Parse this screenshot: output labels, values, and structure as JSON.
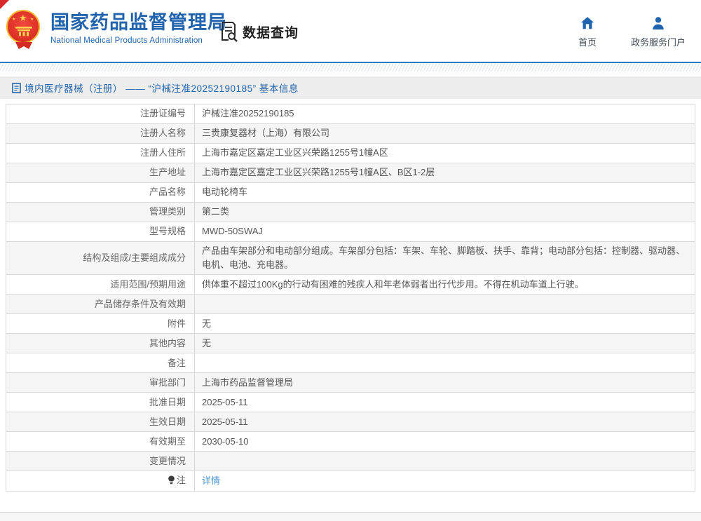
{
  "header": {
    "org_name_cn": "国家药品监督管理局",
    "org_name_en": "National Medical Products Administration",
    "module_title": "数据查询",
    "nav": {
      "home_label": "首页",
      "portal_label": "政务服务门户"
    }
  },
  "breadcrumb": {
    "text": "境内医疗器械（注册） —— “沪械注准20252190185” 基本信息"
  },
  "table": {
    "rows": [
      {
        "label": "注册证编号",
        "value": "沪械注准20252190185"
      },
      {
        "label": "注册人名称",
        "value": "三贵康复器材（上海）有限公司"
      },
      {
        "label": "注册人住所",
        "value": "上海市嘉定区嘉定工业区兴荣路1255号1幢A区"
      },
      {
        "label": "生产地址",
        "value": "上海市嘉定区嘉定工业区兴荣路1255号1幢A区、B区1-2层"
      },
      {
        "label": "产品名称",
        "value": "电动轮椅车"
      },
      {
        "label": "管理类别",
        "value": "第二类"
      },
      {
        "label": "型号规格",
        "value": "MWD-50SWAJ"
      },
      {
        "label": "结构及组成/主要组成成分",
        "value": "产品由车架部分和电动部分组成。车架部分包括：车架、车轮、脚踏板、扶手、靠背；电动部分包括：控制器、驱动器、电机、电池、充电器。"
      },
      {
        "label": "适用范围/预期用途",
        "value": "供体重不超过100Kg的行动有困难的残疾人和年老体弱者出行代步用。不得在机动车道上行驶。"
      },
      {
        "label": "产品储存条件及有效期",
        "value": ""
      },
      {
        "label": "附件",
        "value": "无"
      },
      {
        "label": "其他内容",
        "value": "无"
      },
      {
        "label": "备注",
        "value": ""
      },
      {
        "label": "审批部门",
        "value": "上海市药品监督管理局"
      },
      {
        "label": "批准日期",
        "value": "2025-05-11"
      },
      {
        "label": "生效日期",
        "value": "2025-05-11"
      },
      {
        "label": "有效期至",
        "value": "2030-05-10"
      },
      {
        "label": "变更情况",
        "value": ""
      },
      {
        "label": "注",
        "value": "详情",
        "link": true,
        "label_icon": "bulb-icon"
      }
    ]
  },
  "colors": {
    "brand_blue": "#2164ad",
    "header_rule": "#2e7cc0",
    "breadcrumb_bg": "#ededed",
    "table_border": "#d8d8d8",
    "alt_row_bg": "#f5f5f5",
    "link_blue": "#4b94d6",
    "emblem_red": "#d42a24",
    "emblem_gold": "#f3b32a"
  }
}
